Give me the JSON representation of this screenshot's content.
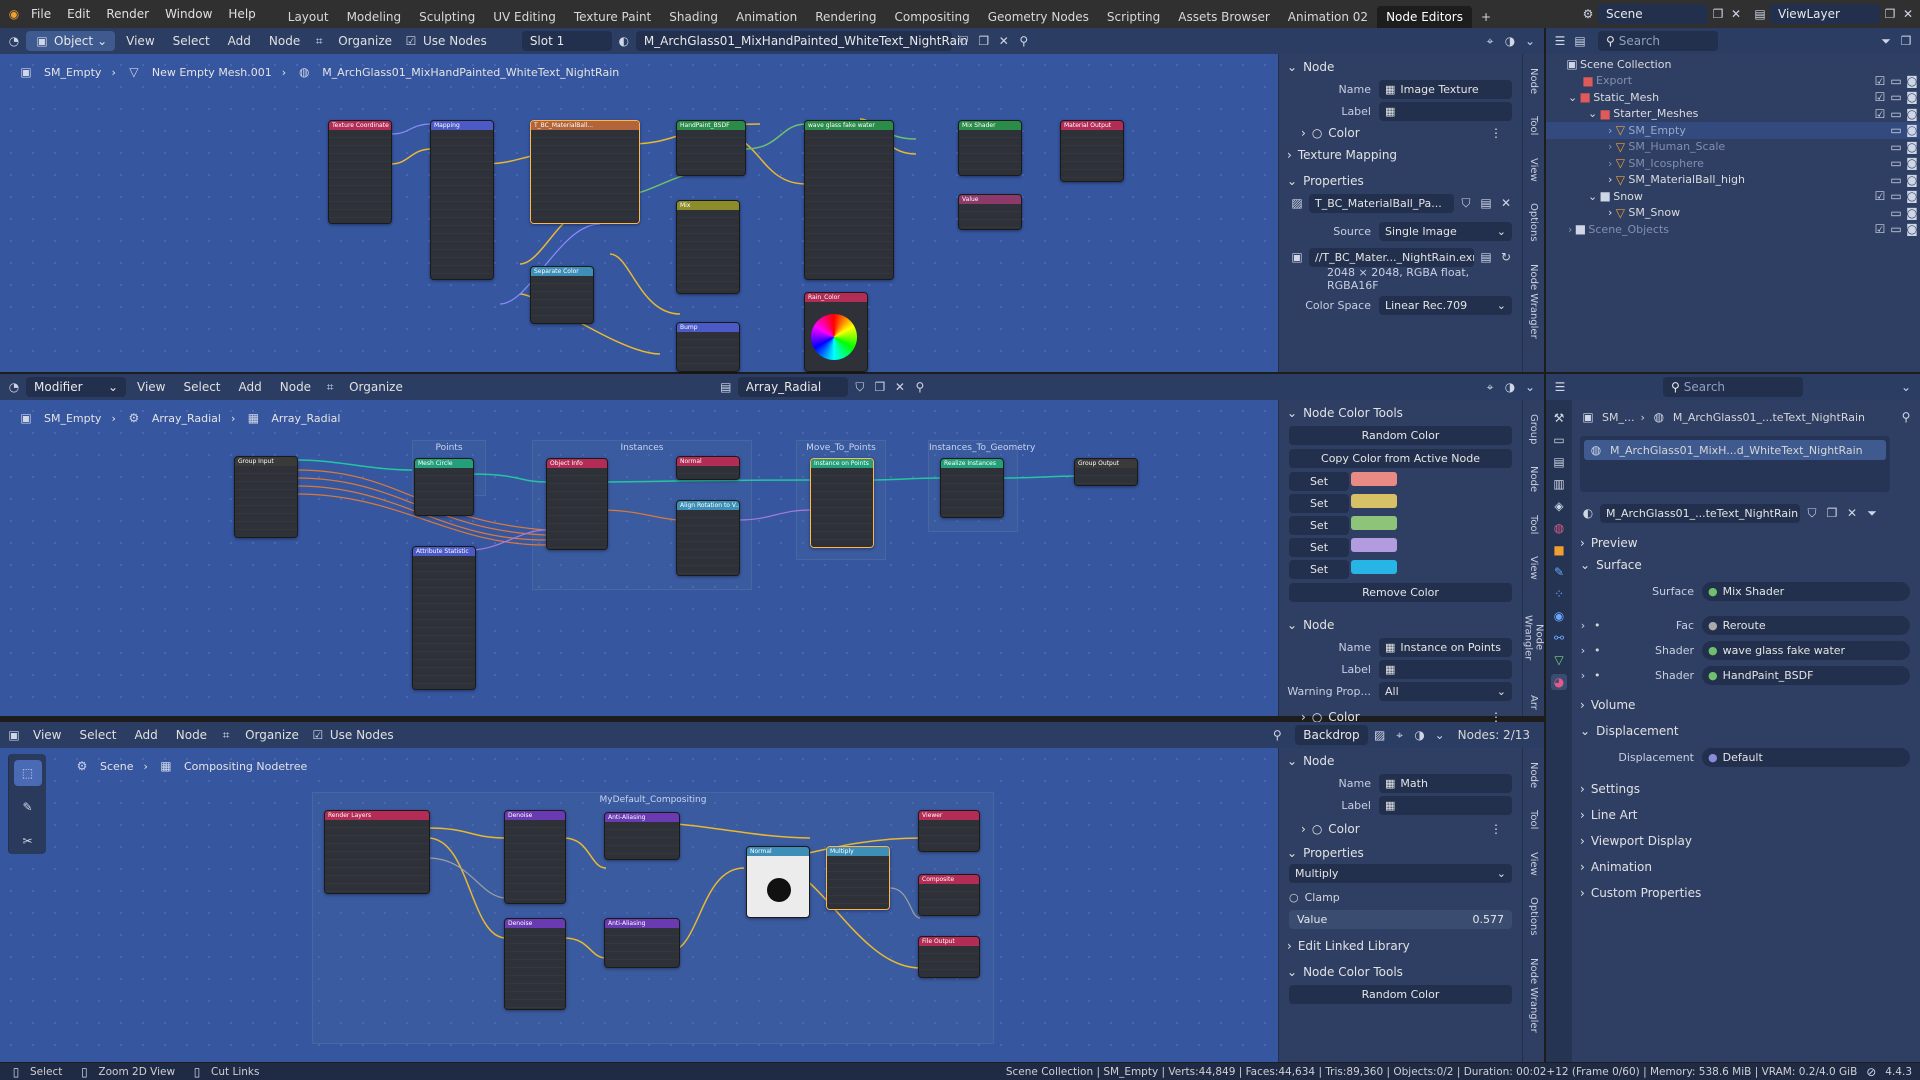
{
  "topbar": {
    "menus": [
      "File",
      "Edit",
      "Render",
      "Window",
      "Help"
    ],
    "workspaces": [
      "Layout",
      "Modeling",
      "Sculpting",
      "UV Editing",
      "Texture Paint",
      "Shading",
      "Animation",
      "Rendering",
      "Compositing",
      "Geometry Nodes",
      "Scripting",
      "Assets Browser",
      "Animation 02",
      "Node Editors"
    ],
    "active_workspace": "Node Editors",
    "scene": "Scene",
    "view_layer": "ViewLayer"
  },
  "editor1": {
    "mode": "Object",
    "menus": [
      "View",
      "Select",
      "Add",
      "Node"
    ],
    "organize": "Organize",
    "use_nodes": "Use Nodes",
    "slot": "Slot 1",
    "material": "M_ArchGlass01_MixHandPainted_WhiteText_NightRain",
    "breadcrumb": [
      "SM_Empty",
      "New Empty Mesh.001",
      "M_ArchGlass01_MixHandPainted_WhiteText_NightRain"
    ],
    "side": {
      "node_title": "Node",
      "name_label": "Name",
      "name_value": "Image Texture",
      "label_label": "Label",
      "color": "Color",
      "texture_mapping": "Texture Mapping",
      "properties": "Properties",
      "image": "T_BC_MaterialBall_Pa...",
      "source_label": "Source",
      "source_value": "Single Image",
      "filepath": "//T_BC_Mater..._NightRain.exr",
      "info": "2048 × 2048,  RGBA float, RGBA16F",
      "colorspace_label": "Color Space",
      "colorspace_value": "Linear Rec.709"
    },
    "vtabs": [
      "Node",
      "Tool",
      "View",
      "Options",
      "Node Wrangler"
    ]
  },
  "editor2": {
    "type": "Modifier",
    "menus": [
      "View",
      "Select",
      "Add",
      "Node"
    ],
    "organize": "Organize",
    "nodetree": "Array_Radial",
    "breadcrumb": [
      "SM_Empty",
      "Array_Radial",
      "Array_Radial"
    ],
    "frames": [
      "Points",
      "Instances",
      "Move_To_Points",
      "Instances_To_Geometry"
    ],
    "side": {
      "color_tools": "Node Color Tools",
      "random_color": "Random Color",
      "copy_color": "Copy Color from Active Node",
      "set": "Set",
      "swatches": [
        "#e98a84",
        "#d8c067",
        "#8ec47a",
        "#b39be0",
        "#27b5e6"
      ],
      "remove_color": "Remove Color",
      "node_title": "Node",
      "name_label": "Name",
      "name_value": "Instance on Points",
      "label_label": "Label",
      "warning_label": "Warning Prop...",
      "warning_value": "All",
      "color": "Color"
    },
    "vtabs": [
      "Group",
      "Node",
      "Tool",
      "View",
      "Node Wrangler",
      "Arr"
    ]
  },
  "editor3": {
    "menus": [
      "View",
      "Select",
      "Add",
      "Node"
    ],
    "organize": "Organize",
    "use_nodes": "Use Nodes",
    "backdrop": "Backdrop",
    "nodes_count": "Nodes: 2/13",
    "breadcrumb": [
      "Scene",
      "Compositing Nodetree"
    ],
    "frame": "MyDefault_Compositing",
    "side": {
      "node_title": "Node",
      "name_label": "Name",
      "name_value": "Math",
      "label_label": "Label",
      "color": "Color",
      "properties": "Properties",
      "operation": "Multiply",
      "clamp": "Clamp",
      "value_label": "Value",
      "value": "0.577",
      "edit_linked": "Edit Linked Library",
      "color_tools": "Node Color Tools",
      "random_color": "Random Color"
    },
    "vtabs": [
      "Node",
      "Tool",
      "View",
      "Options",
      "Node Wrangler"
    ]
  },
  "outliner": {
    "search_placeholder": "Search",
    "root": "Scene Collection",
    "items": [
      {
        "name": "Export",
        "indent": 1
      },
      {
        "name": "Static_Mesh",
        "indent": 1
      },
      {
        "name": "Starter_Meshes",
        "indent": 2
      },
      {
        "name": "SM_Empty",
        "indent": 3
      },
      {
        "name": "SM_Human_Scale",
        "indent": 3
      },
      {
        "name": "SM_Icosphere",
        "indent": 3
      },
      {
        "name": "SM_MaterialBall_high",
        "indent": 3
      },
      {
        "name": "Snow",
        "indent": 2
      },
      {
        "name": "SM_Snow",
        "indent": 3
      },
      {
        "name": "Scene_Objects",
        "indent": 1
      }
    ]
  },
  "properties": {
    "search_placeholder": "Search",
    "breadcrumb_obj": "SM_...",
    "breadcrumb_mat": "M_ArchGlass01_...teText_NightRain",
    "slot_material": "M_ArchGlass01_MixH...d_WhiteText_NightRain",
    "material_field": "M_ArchGlass01_...teText_NightRain",
    "sections": {
      "preview": "Preview",
      "surface": "Surface",
      "volume": "Volume",
      "displacement": "Displacement",
      "settings": "Settings",
      "line_art": "Line Art",
      "viewport_display": "Viewport Display",
      "animation": "Animation",
      "custom_properties": "Custom Properties"
    },
    "surface_label": "Surface",
    "surface_value": "Mix Shader",
    "fac_label": "Fac",
    "fac_value": "Reroute",
    "shader1_label": "Shader",
    "shader1_value": "wave glass fake water",
    "shader2_label": "Shader",
    "shader2_value": "HandPaint_BSDF",
    "displacement_label": "Displacement",
    "displacement_value": "Default"
  },
  "statusbar": {
    "select": "Select",
    "zoom": "Zoom 2D View",
    "cut": "Cut Links",
    "info": "Scene Collection | SM_Empty | Verts:44,849 | Faces:44,634 | Tris:89,360 | Objects:0/2 | Duration: 00:02+12 (Frame 0/60) | Memory: 538.6 MiB | VRAM: 0.2/4.0 GiB",
    "version": "4.4.3"
  }
}
